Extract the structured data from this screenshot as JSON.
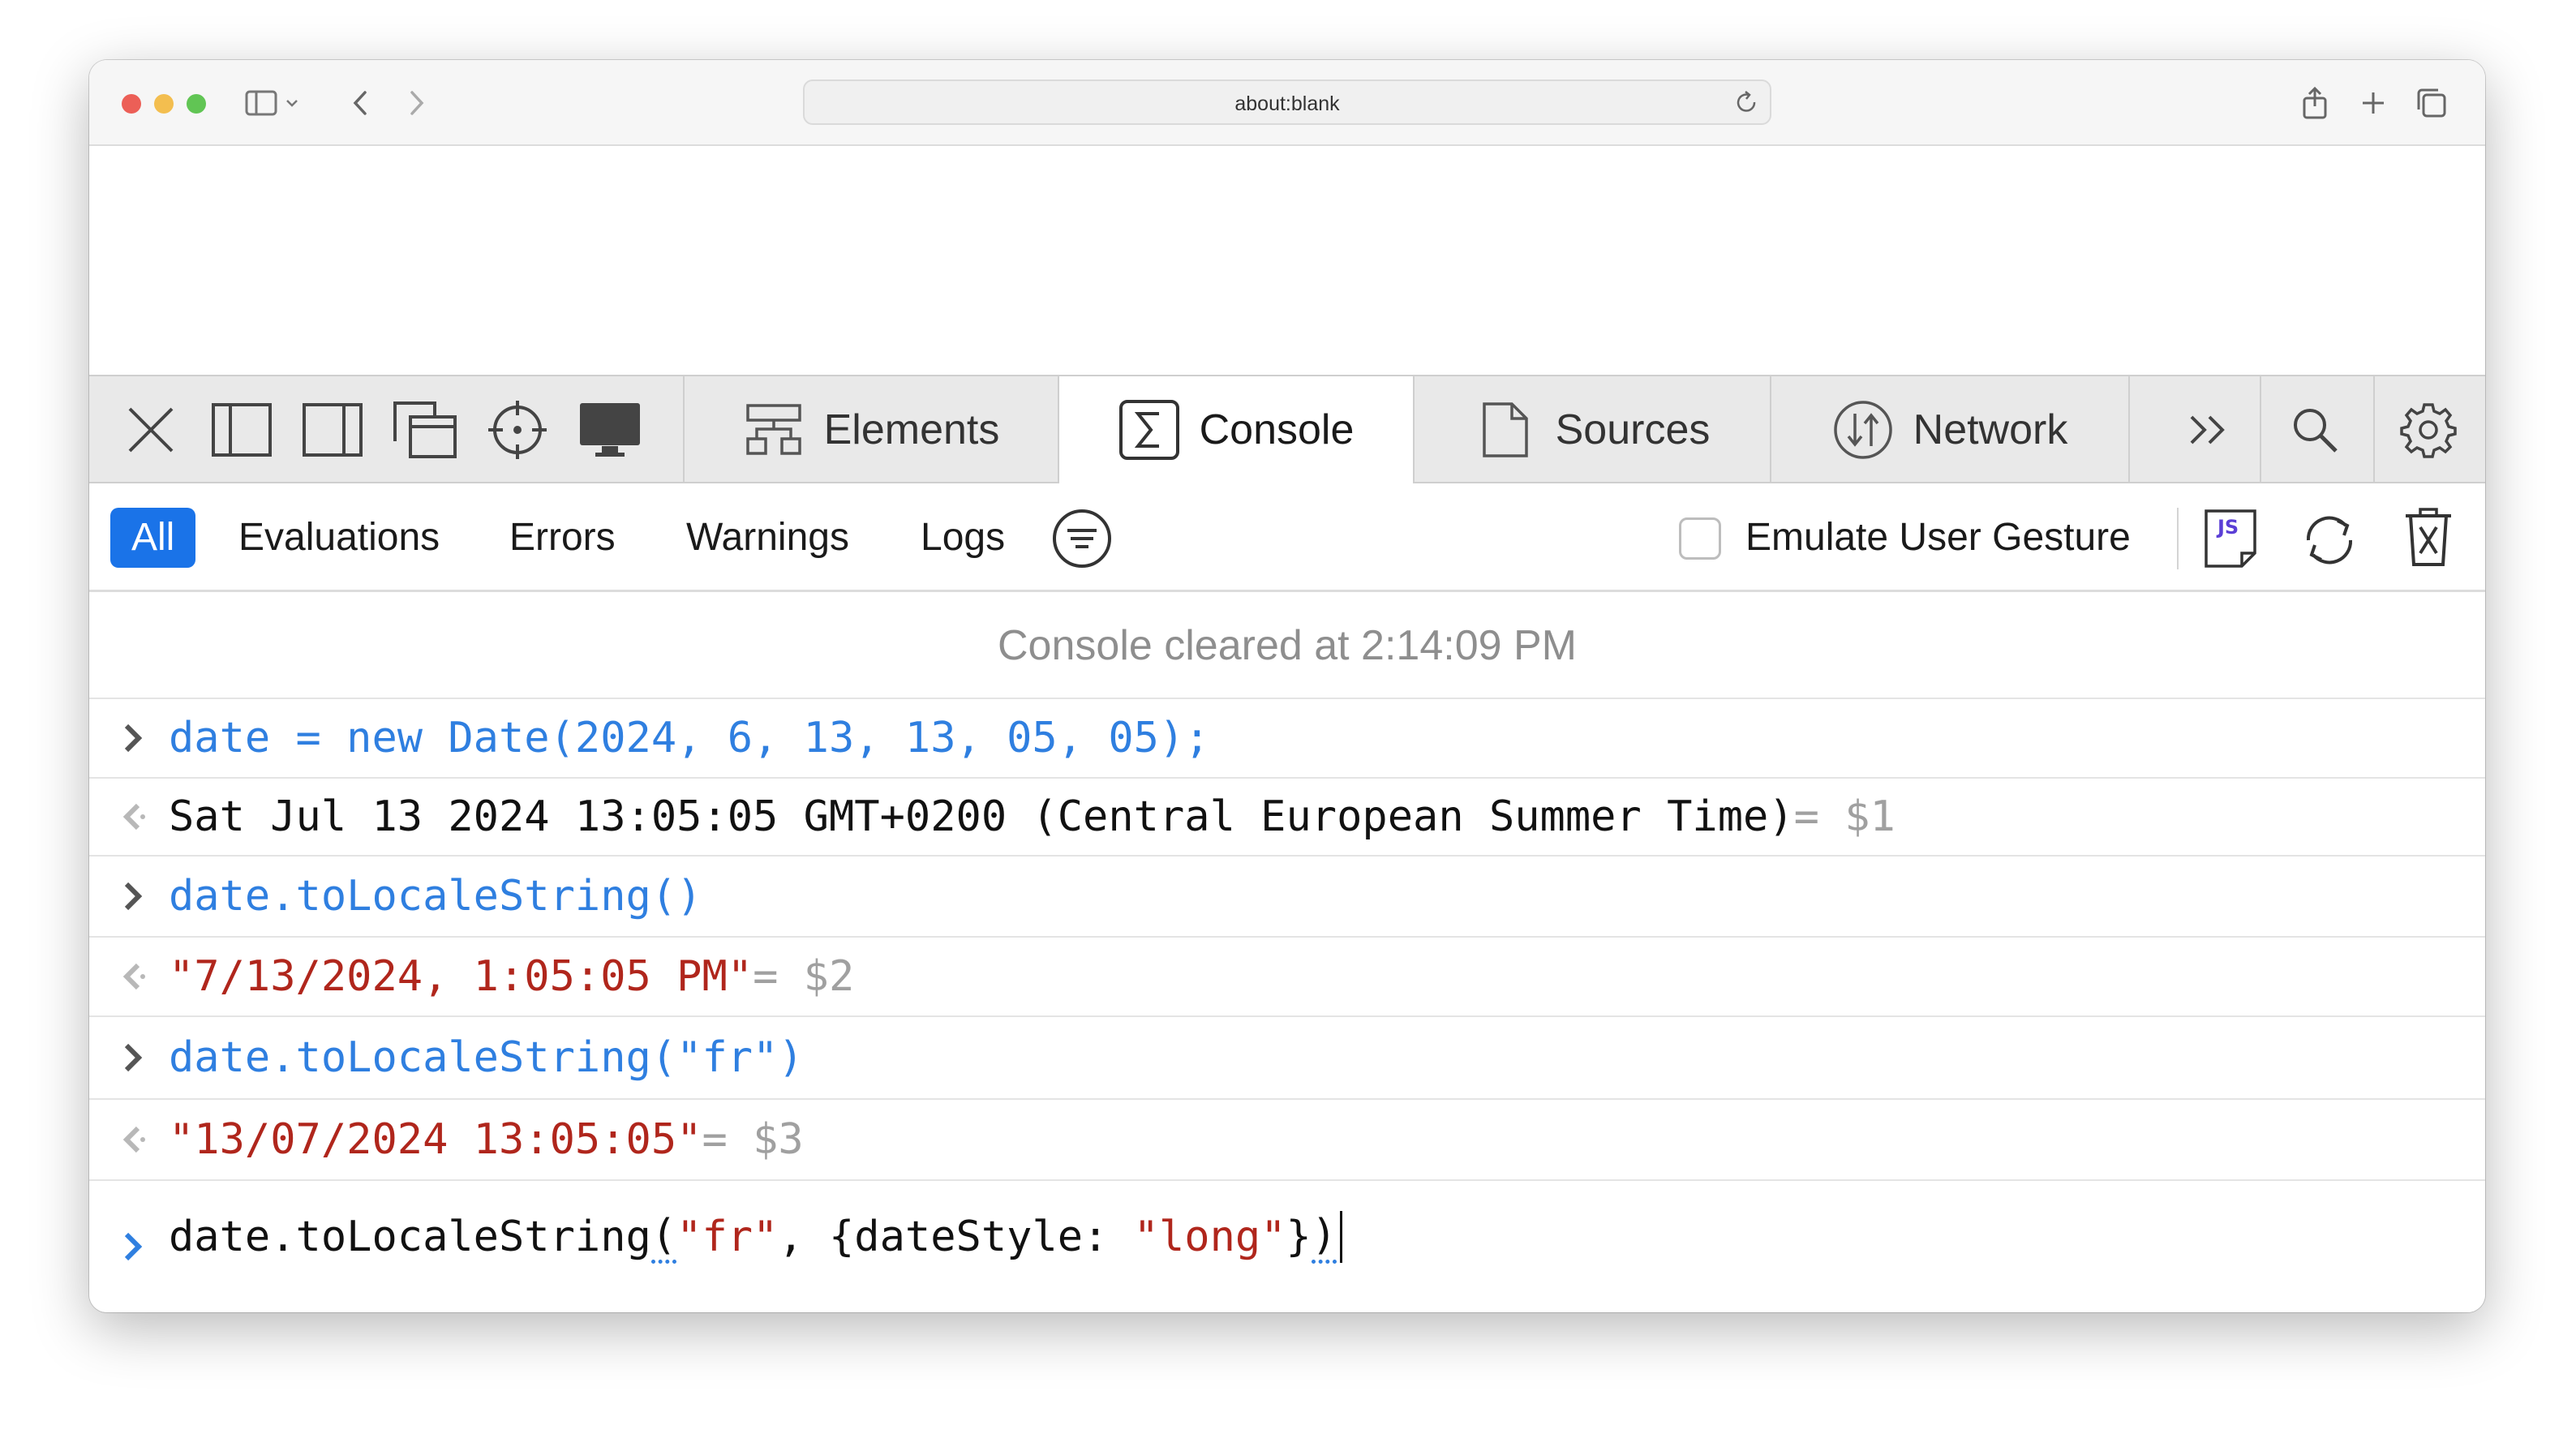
{
  "browser": {
    "url": "about:blank"
  },
  "devtools": {
    "tabs": [
      {
        "label": "Elements"
      },
      {
        "label": "Console"
      },
      {
        "label": "Sources"
      },
      {
        "label": "Network"
      }
    ],
    "active_tab": "Console"
  },
  "filters": {
    "items": [
      "All",
      "Evaluations",
      "Errors",
      "Warnings",
      "Logs"
    ],
    "selected": "All",
    "emulate_label": "Emulate User Gesture",
    "emulate_checked": false
  },
  "console": {
    "cleared_message": "Console cleared at 2:14:09 PM",
    "entries": [
      {
        "kind": "input",
        "text": "date = new Date(2024, 6, 13, 13, 05, 05);"
      },
      {
        "kind": "output",
        "text": "Sat Jul 13 2024 13:05:05 GMT+0200 (Central European Summer Time)",
        "ref": "= $1"
      },
      {
        "kind": "input",
        "text": "date.toLocaleString()"
      },
      {
        "kind": "output",
        "text": "\"7/13/2024, 1:05:05 PM\"",
        "ref": "= $2"
      },
      {
        "kind": "input",
        "text": "date.toLocaleString(\"fr\")"
      },
      {
        "kind": "output",
        "text": "\"13/07/2024 13:05:05\"",
        "ref": "= $3"
      }
    ],
    "prompt": {
      "part1": "date.toLocaleString",
      "part2": "(",
      "part3": "\"fr\"",
      "part4": ", {dateStyle: ",
      "part5": "\"long\"",
      "part6": "}",
      "part7": ")"
    }
  },
  "colors": {
    "accent": "#1a73e8",
    "code_blue": "#2f7fe0",
    "string_red": "#b0261c"
  }
}
